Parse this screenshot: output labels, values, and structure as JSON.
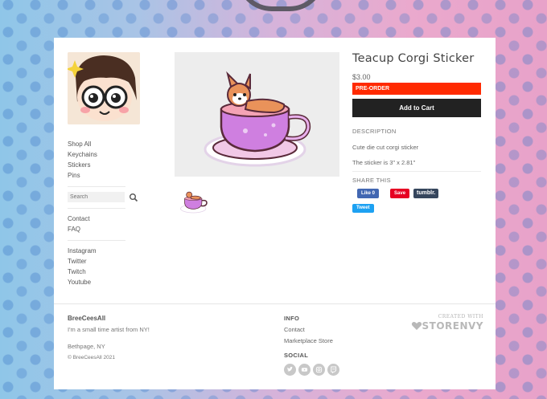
{
  "product": {
    "title": "Teacup Corgi Sticker",
    "price": "$3.00",
    "badge": "PRE-ORDER",
    "add_to_cart": "Add to Cart",
    "description_label": "DESCRIPTION",
    "description_lines": [
      "Cute die cut corgi sticker",
      "The sticker is 3\" x 2.81\""
    ],
    "share_label": "SHARE THIS",
    "share_buttons": {
      "like": "Like 0",
      "save": "Save",
      "tumblr": "tumblr.",
      "tweet": "Tweet"
    }
  },
  "sidebar": {
    "shop_links": [
      "Shop All",
      "Keychains",
      "Stickers",
      "Pins"
    ],
    "search_placeholder": "Search",
    "info_links": [
      "Contact",
      "FAQ"
    ],
    "social_links": [
      "Instagram",
      "Twitter",
      "Twitch",
      "Youtube"
    ]
  },
  "footer": {
    "brand": "BreeCeesAll",
    "tagline": "I'm a small time artist from NY!",
    "location": "Bethpage, NY",
    "copyright": "© BreeCeesAll 2021",
    "info_heading": "INFO",
    "info_links": [
      "Contact",
      "Marketplace Store"
    ],
    "social_heading": "SOCIAL",
    "social_icons": [
      "twitter-icon",
      "youtube-icon",
      "instagram-icon",
      "twitch-icon"
    ],
    "created_with": "CREATED WITH",
    "storenvy": "STORENVY"
  },
  "colors": {
    "accent_red": "#ff2a00",
    "cart_button": "#222222",
    "facebook": "#4267b2",
    "pinterest": "#e60023",
    "tumblr": "#36465d",
    "twitter": "#1da1f2"
  }
}
